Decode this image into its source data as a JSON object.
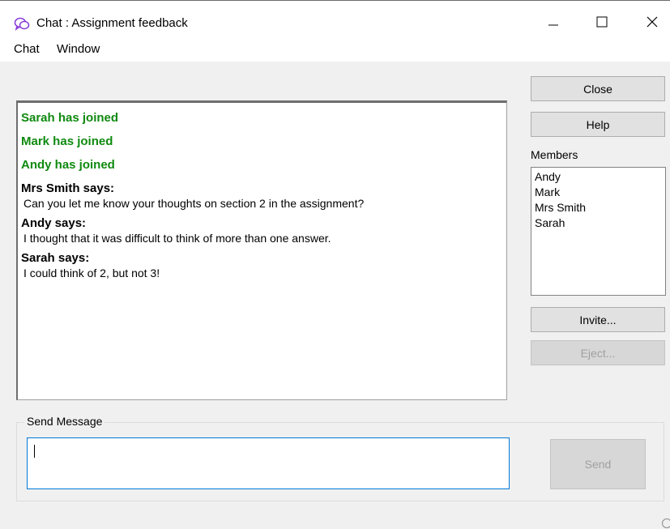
{
  "window": {
    "title": "Chat : Assignment feedback",
    "icon": "chat-bubbles-icon",
    "controls": [
      "minimize-icon",
      "maximize-icon",
      "close-icon"
    ]
  },
  "menu": {
    "items": [
      "Chat",
      "Window"
    ]
  },
  "chat": {
    "joins": [
      "Sarah has joined",
      "Mark has joined",
      "Andy has joined"
    ],
    "messages": [
      {
        "sender": "Mrs Smith says:",
        "text": "Can you let me know your thoughts on section 2 in the assignment?"
      },
      {
        "sender": "Andy says:",
        "text": "I thought that it was difficult to think of more than one answer."
      },
      {
        "sender": "Sarah says:",
        "text": "I could think of 2, but not 3!"
      }
    ]
  },
  "buttons": {
    "close": "Close",
    "help": "Help",
    "invite": "Invite...",
    "eject": "Eject...",
    "send": "Send"
  },
  "members": {
    "label": "Members",
    "list": [
      "Andy",
      "Mark",
      "Mrs Smith",
      "Sarah"
    ]
  },
  "send_message": {
    "label": "Send Message",
    "value": ""
  },
  "colors": {
    "join_text": "#0f8a0f",
    "input_focus": "#0078d7",
    "app_icon": "#8b3fd9"
  }
}
